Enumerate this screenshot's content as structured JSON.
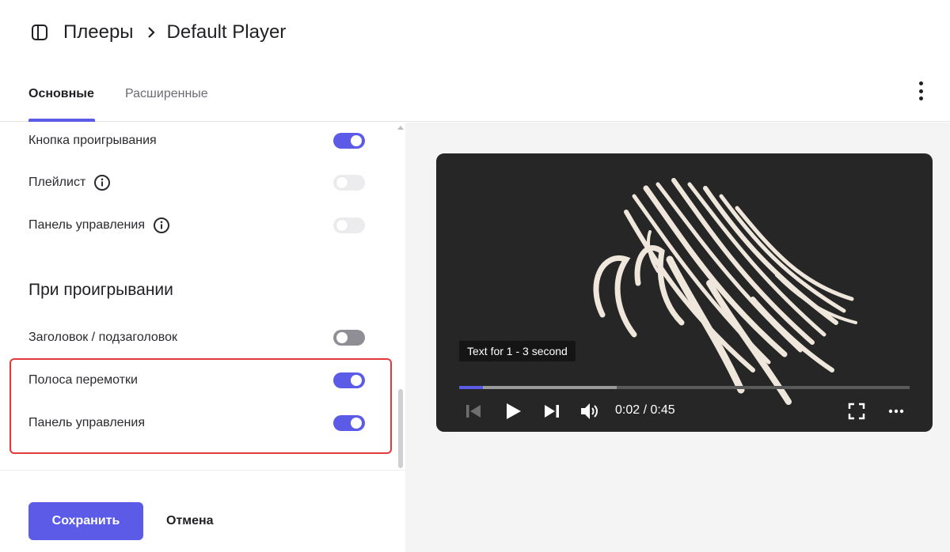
{
  "breadcrumb": {
    "parent": "Плееры",
    "current": "Default Player"
  },
  "tabs": [
    {
      "label": "Основные",
      "active": true
    },
    {
      "label": "Расширенные",
      "active": false
    }
  ],
  "settings": {
    "play_button": {
      "label": "Кнопка проигрывания",
      "enabled": true
    },
    "playlist": {
      "label": "Плейлист",
      "enabled": false
    },
    "control_panel_top": {
      "label": "Панель управления",
      "enabled": false
    },
    "section_title": "При проигрывании",
    "title_subtitle": {
      "label": "Заголовок / подзаголовок",
      "enabled": false
    },
    "seek_bar": {
      "label": "Полоса перемотки",
      "enabled": true
    },
    "control_panel_playback": {
      "label": "Панель управления",
      "enabled": true
    }
  },
  "footer": {
    "save_label": "Сохранить",
    "cancel_label": "Отмена"
  },
  "player": {
    "caption": "Text for 1 - 3 second",
    "time": "0:02 / 0:45",
    "played_fraction": 0.053,
    "buffered_fraction": 0.35
  },
  "colors": {
    "accent": "#5b5be8",
    "highlight_border": "#e03a3a",
    "preview_background": "#f4f4f5",
    "player_background": "#262626"
  },
  "icons": {
    "sidebar_toggle": "panel-icon",
    "breadcrumb_separator": "chevron-right-icon",
    "more": "kebab-icon",
    "info": "info-icon",
    "previous": "skip-back-icon",
    "play": "play-icon",
    "next": "skip-forward-icon",
    "volume": "volume-icon",
    "fullscreen": "fullscreen-icon",
    "settings": "more-horizontal-icon"
  }
}
